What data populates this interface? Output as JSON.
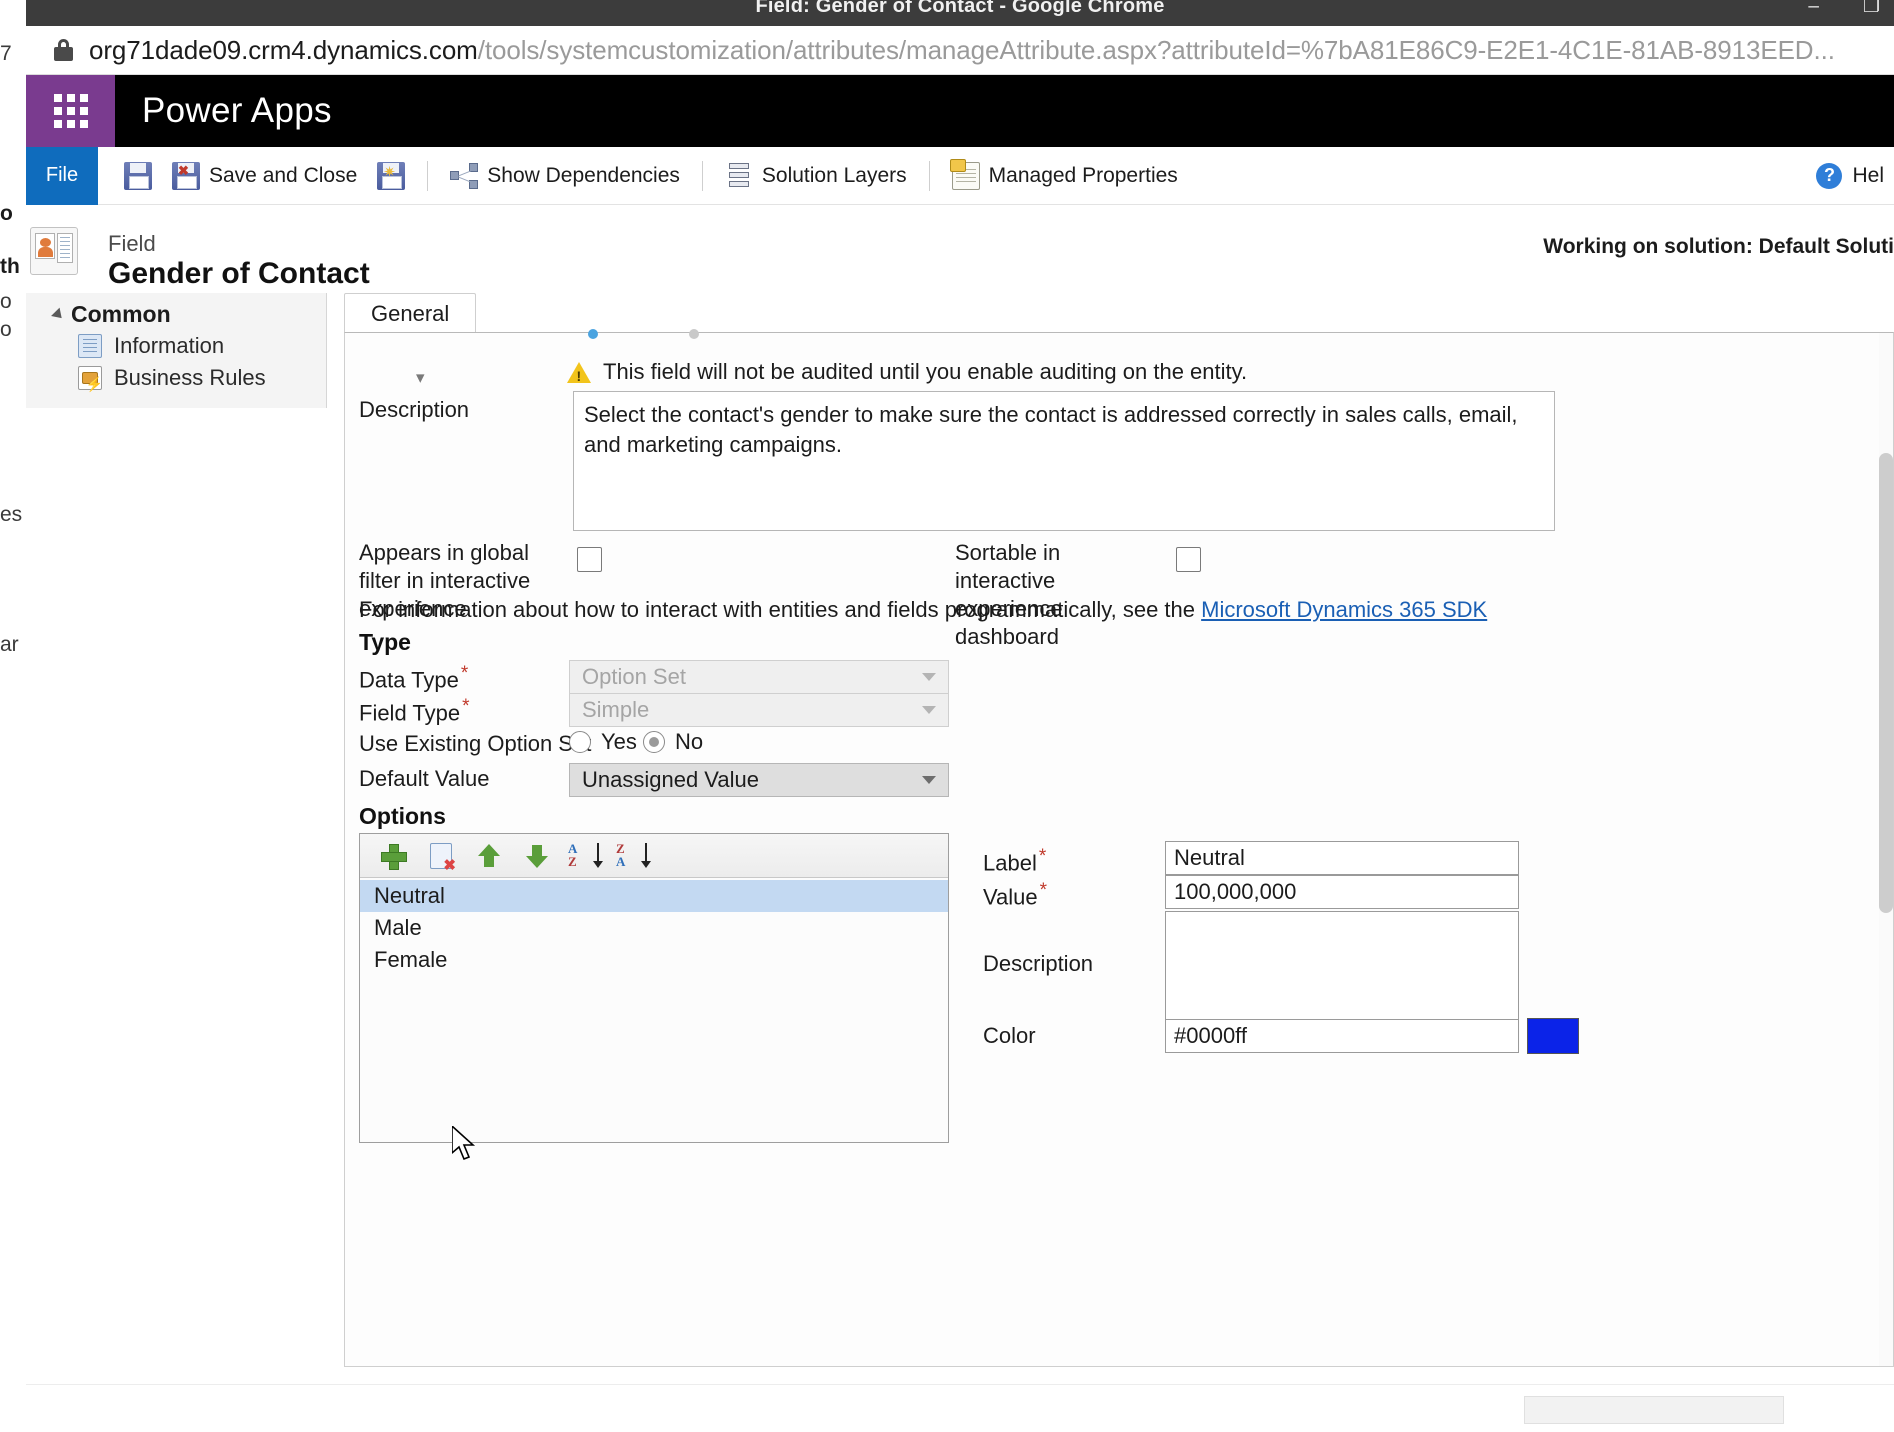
{
  "browser": {
    "window_title": "Field: Gender of Contact - Google Chrome",
    "minimize": "–",
    "maximize": "❐",
    "close": "✕",
    "url_host": "org71dade09.crm4.dynamics.com",
    "url_path": "/tools/systemcustomization/attributes/manageAttribute.aspx?attributeId=%7bA81E86C9-E2E1-4C1E-81AB-8913EED...",
    "lock_icon": "lock-icon"
  },
  "background_window": {
    "fragments": [
      "7",
      "o",
      "th",
      "o",
      "o",
      "es",
      "ar"
    ]
  },
  "app_bar": {
    "waffle_icon": "app-launcher-icon",
    "title": "Power Apps"
  },
  "ribbon": {
    "file_tab": "File",
    "buttons": [
      {
        "label": "",
        "icon": "save-icon",
        "name": "save-button"
      },
      {
        "label": "Save and Close",
        "icon": "save-and-close-icon",
        "name": "save-and-close-button"
      },
      {
        "label": "",
        "icon": "save-and-new-icon",
        "name": "save-and-new-button"
      },
      {
        "label": "Show Dependencies",
        "icon": "dependencies-icon",
        "name": "show-dependencies-button"
      },
      {
        "label": "Solution Layers",
        "icon": "layers-icon",
        "name": "solution-layers-button"
      },
      {
        "label": "Managed Properties",
        "icon": "managed-properties-icon",
        "name": "managed-properties-button"
      }
    ],
    "help_label": "Hel",
    "help_icon": "help-icon"
  },
  "field_header": {
    "kicker": "Field",
    "title": "Gender of Contact",
    "icon": "field-record-icon",
    "solution_note": "Working on solution: Default Soluti"
  },
  "left_nav": {
    "group": "Common",
    "items": [
      {
        "label": "Information",
        "icon": "information-icon"
      },
      {
        "label": "Business Rules",
        "icon": "business-rules-icon"
      }
    ]
  },
  "tabs": [
    {
      "label": "General"
    }
  ],
  "form": {
    "audit_warning": "This field will not be audited until you enable auditing on the entity.",
    "warning_icon": "warning-triangle-icon",
    "description_label": "Description",
    "description_value": "Select the contact's gender to make sure the contact is addressed correctly in sales calls, email, and marketing campaigns.",
    "global_filter_label": "Appears in global filter in interactive experience",
    "global_filter_checked": false,
    "sortable_label": "Sortable in interactive experience dashboard",
    "sortable_checked": false,
    "sdk_prefix": "For information about how to interact with entities and fields programmatically, see the ",
    "sdk_link": "Microsoft Dynamics 365 SDK",
    "type_heading": "Type",
    "data_type_label": "Data Type",
    "data_type_value": "Option Set",
    "field_type_label": "Field Type",
    "field_type_value": "Simple",
    "use_existing_label": "Use Existing Option Set",
    "use_existing_yes": "Yes",
    "use_existing_no": "No",
    "use_existing_selected": "No",
    "default_value_label": "Default Value",
    "default_value_value": "Unassigned Value",
    "options_heading": "Options"
  },
  "options_toolbar": [
    {
      "name": "add-option-button",
      "icon": "plus-icon"
    },
    {
      "name": "delete-option-button",
      "icon": "delete-icon"
    },
    {
      "name": "move-up-button",
      "icon": "arrow-up-icon"
    },
    {
      "name": "move-down-button",
      "icon": "arrow-down-icon"
    },
    {
      "name": "sort-ascending-button",
      "icon": "sort-az-icon",
      "top": "A",
      "bottom": "Z"
    },
    {
      "name": "sort-descending-button",
      "icon": "sort-za-icon",
      "top": "Z",
      "bottom": "A"
    }
  ],
  "options_list": [
    {
      "label": "Neutral",
      "selected": true
    },
    {
      "label": "Male",
      "selected": false
    },
    {
      "label": "Female",
      "selected": false
    }
  ],
  "option_detail": {
    "label_label": "Label",
    "label_value": "Neutral",
    "value_label": "Value",
    "value_value": "100,000,000",
    "description_label": "Description",
    "description_value": "",
    "color_label": "Color",
    "color_value": "#0000ff",
    "color_swatch_hex": "#0b23e8"
  }
}
